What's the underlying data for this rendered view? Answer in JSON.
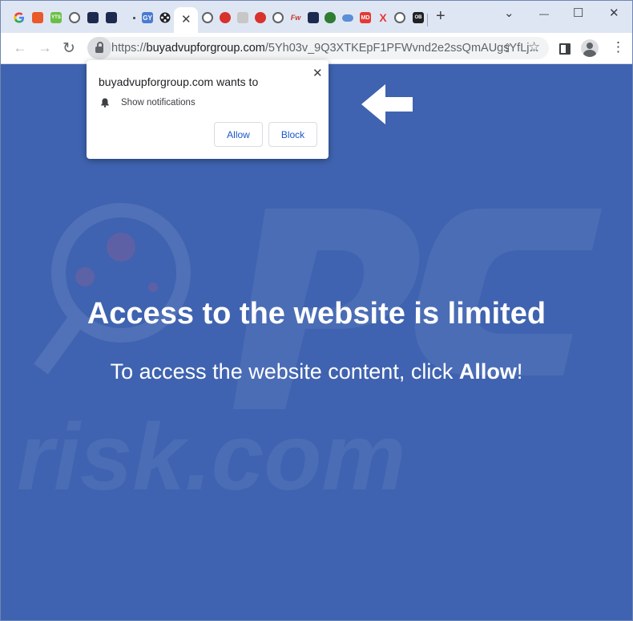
{
  "tabs": {
    "favicons": [
      "google",
      "recipe",
      "yts",
      "globe",
      "dark-square",
      "dark-square",
      "dot",
      "gy",
      "film-reel",
      "globe",
      "red-circle",
      "figure",
      "red-circle",
      "globe",
      "fw",
      "dark-square",
      "alien",
      "link",
      "md",
      "x",
      "globe",
      "ob"
    ],
    "active_close": "✕",
    "new_tab": "+",
    "gy_text": "GY",
    "md_text": "MD",
    "x_text": "X",
    "fw_text": "Fw",
    "yts_text": "YTS",
    "ob_text": "OB"
  },
  "window_controls": {
    "chevron": "⌄",
    "minimize": "—",
    "maximize": "☐",
    "close": "✕"
  },
  "toolbar": {
    "back": "←",
    "forward": "→",
    "reload": "↻",
    "url_protocol": "https://",
    "url_host": "buyadvupforgroup.com",
    "url_path": "/5Yh03v_9Q3XTKEpF1PFWvnd2e2ssQmAUgsYfLj...",
    "share": "⇪",
    "star": "☆",
    "menu": "⋮"
  },
  "popup": {
    "title": "buyadvupforgroup.com wants to",
    "permission": "Show notifications",
    "close": "✕",
    "allow": "Allow",
    "block": "Block"
  },
  "page": {
    "heading": "Access to the website is limited",
    "sub_before": "To access the website content, click ",
    "sub_bold": "Allow",
    "sub_after": "!",
    "background": "#3f63b0"
  },
  "watermark": {
    "text": "risk.com"
  }
}
